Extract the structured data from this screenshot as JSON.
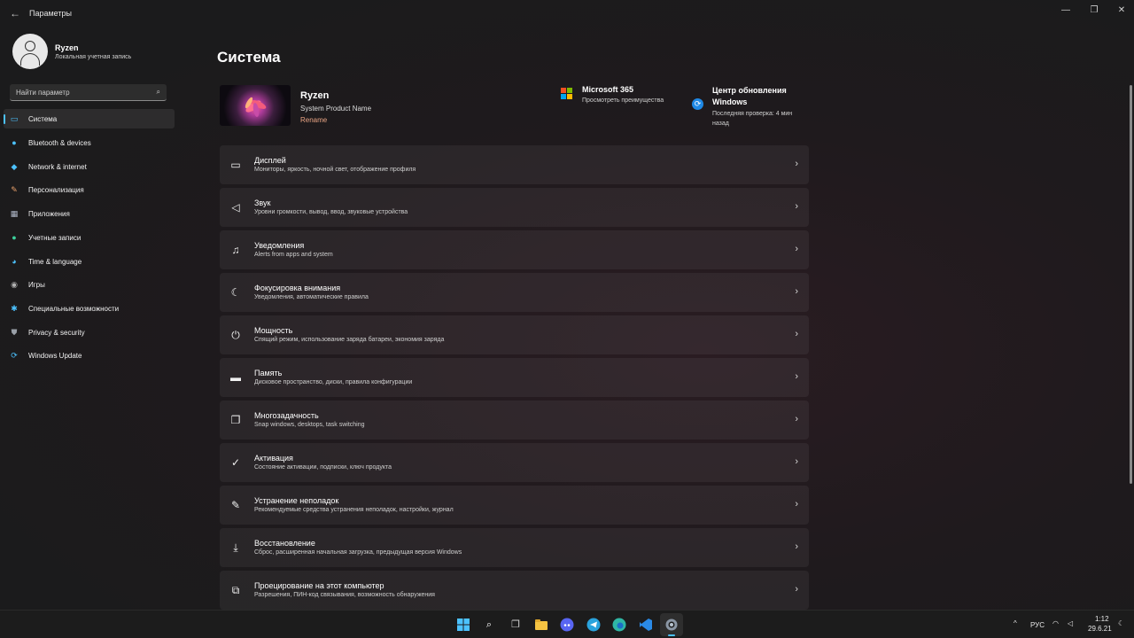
{
  "window": {
    "title": "Параметры",
    "back_icon": "arrow-left-icon",
    "controls": [
      "minimize-icon",
      "maximize-icon",
      "close-icon"
    ]
  },
  "profile": {
    "name": "Ryzen",
    "account_type": "Локальная учетная запись"
  },
  "search": {
    "placeholder": "Найти параметр"
  },
  "sidebar": {
    "items": [
      {
        "label": "Система",
        "icon": "system-icon",
        "icon_color": "#4cc2ff",
        "active": true
      },
      {
        "label": "Bluetooth & devices",
        "icon": "bluetooth-icon",
        "icon_color": "#4cc2ff"
      },
      {
        "label": "Network & internet",
        "icon": "wifi-icon",
        "icon_color": "#4cc2ff"
      },
      {
        "label": "Персонализация",
        "icon": "brush-icon",
        "icon_color": "#e8a06b"
      },
      {
        "label": "Приложения",
        "icon": "apps-icon",
        "icon_color": "#b0b8c8"
      },
      {
        "label": "Учетные записи",
        "icon": "person-icon",
        "icon_color": "#3ccf9b"
      },
      {
        "label": "Time & language",
        "icon": "globe-clock-icon",
        "icon_color": "#4cc2ff"
      },
      {
        "label": "Игры",
        "icon": "gamepad-icon",
        "icon_color": "#b0b0b0"
      },
      {
        "label": "Специальные возможности",
        "icon": "accessibility-icon",
        "icon_color": "#4cc2ff"
      },
      {
        "label": "Privacy & security",
        "icon": "shield-icon",
        "icon_color": "#9aa0a8"
      },
      {
        "label": "Windows Update",
        "icon": "update-icon",
        "icon_color": "#4cc2ff"
      }
    ]
  },
  "main": {
    "title": "Система",
    "device": {
      "name": "Ryzen",
      "model": "System Product Name",
      "rename": "Rename"
    },
    "ms365": {
      "title": "Microsoft 365",
      "subtitle": "Просмотреть преимущества",
      "colors": [
        "#f25022",
        "#7fba00",
        "#00a4ef",
        "#ffb900"
      ]
    },
    "update": {
      "title": "Центр обновления Windows",
      "subtitle": "Последняя проверка: 4 мин назад"
    },
    "cards": [
      {
        "title": "Дисплей",
        "subtitle": "Мониторы, яркость, ночной свет, отображение профиля",
        "icon": "display-icon"
      },
      {
        "title": "Звук",
        "subtitle": "Уровни громкости, вывод, ввод, звуковые устройства",
        "icon": "speaker-icon"
      },
      {
        "title": "Уведомления",
        "subtitle": "Alerts from apps and system",
        "icon": "bell-icon"
      },
      {
        "title": "Фокусировка внимания",
        "subtitle": "Уведомления, автоматические правила",
        "icon": "moon-icon"
      },
      {
        "title": "Мощность",
        "subtitle": "Спящий режим, использование заряда батареи, экономия заряда",
        "icon": "power-icon"
      },
      {
        "title": "Память",
        "subtitle": "Дисковое пространство, диски, правила конфигурации",
        "icon": "storage-icon"
      },
      {
        "title": "Многозадачность",
        "subtitle": "Snap windows, desktops, task switching",
        "icon": "multitask-icon"
      },
      {
        "title": "Активация",
        "subtitle": "Состояние активации, подписки, ключ продукта",
        "icon": "check-circle-icon"
      },
      {
        "title": "Устранение неполадок",
        "subtitle": "Рекомендуемые средства устранения неполадок, настройки, журнал",
        "icon": "wrench-icon"
      },
      {
        "title": "Восстановление",
        "subtitle": "Сброс, расширенная начальная загрузка, предыдущая версия Windows",
        "icon": "recovery-icon"
      },
      {
        "title": "Проецирование на этот компьютер",
        "subtitle": "Разрешения, ПИН-код связывания, возможность обнаружения",
        "icon": "projection-icon"
      }
    ]
  },
  "taskbar": {
    "apps": [
      {
        "name": "start-icon",
        "color": "#4cc2ff"
      },
      {
        "name": "search-icon",
        "color": "#ffffff"
      },
      {
        "name": "task-view-icon",
        "color": "#d0d0d0"
      },
      {
        "name": "file-explorer-icon",
        "color": "#f5c342"
      },
      {
        "name": "discord-icon",
        "color": "#5865f2"
      },
      {
        "name": "telegram-icon",
        "color": "#2aa3dd"
      },
      {
        "name": "edge-icon",
        "color": "#2fb7a5"
      },
      {
        "name": "vscode-icon",
        "color": "#2a8ae6"
      },
      {
        "name": "settings-icon",
        "color": "#b8c4d0"
      }
    ],
    "tray": {
      "chevron": "^",
      "language": "РУС",
      "time": "1:12",
      "date": "29.6.21"
    }
  }
}
